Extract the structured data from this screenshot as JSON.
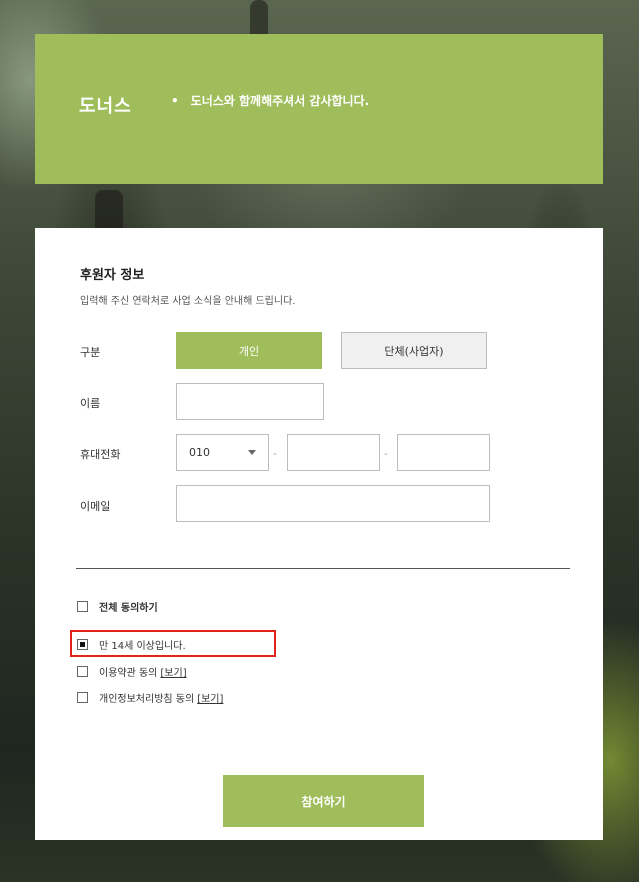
{
  "header": {
    "brand": "도너스",
    "bullet": "•",
    "thanks": "도너스와 함께해주셔서 감사합니다."
  },
  "form": {
    "title": "후원자 정보",
    "description": "입력해 주신 연락처로 사업 소식을 안내해 드립니다.",
    "type_label": "구분",
    "type_options": [
      "개인",
      "단체(사업자)"
    ],
    "type_selected": "개인",
    "name_label": "이름",
    "name_value": "",
    "phone_label": "휴대전화",
    "phone_prefix": "010",
    "phone_separator": "-",
    "phone_middle": "",
    "phone_last": "",
    "email_label": "이메일",
    "email_value": ""
  },
  "agreements": {
    "all": {
      "label": "전체 동의하기",
      "checked": false
    },
    "age": {
      "label": "만 14세 이상입니다.",
      "checked": true
    },
    "terms": {
      "label": "이용약관 동의",
      "link": "[보기]",
      "checked": false
    },
    "privacy": {
      "label": "개인정보처리방침 동의",
      "link": "[보기]",
      "checked": false
    }
  },
  "submit_label": "참여하기",
  "colors": {
    "accent": "#9fbd5a",
    "highlight": "#e0231b"
  }
}
